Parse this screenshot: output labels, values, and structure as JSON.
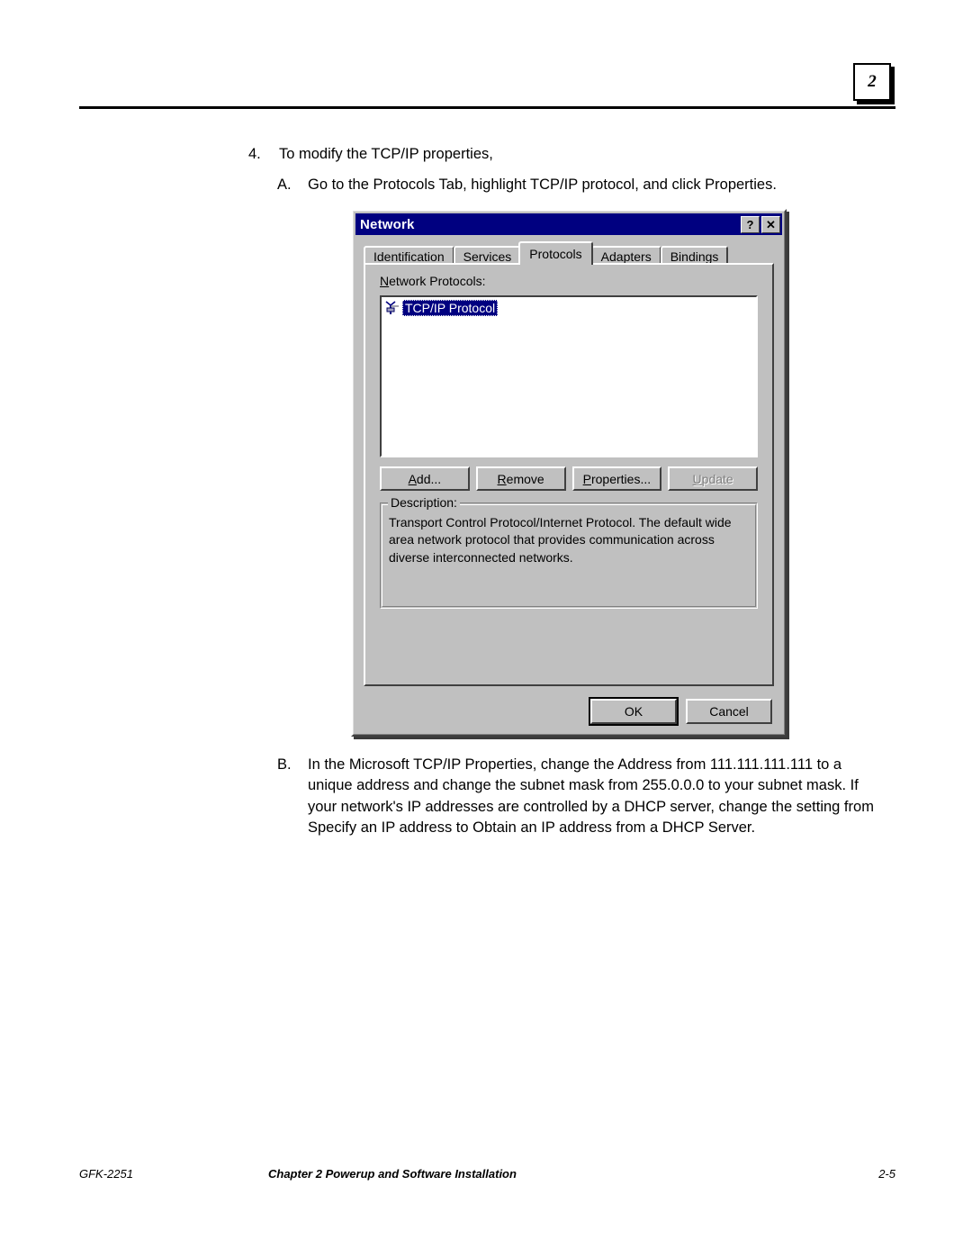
{
  "page": {
    "chapter_marker": "2",
    "footer": {
      "doc_id": "GFK-2251",
      "chapter_title": "Chapter 2  Powerup and Software Installation",
      "page_number": "2-5"
    }
  },
  "instructions": {
    "step4": {
      "marker": "4.",
      "text": "To modify the TCP/IP properties,"
    },
    "step4a": {
      "marker": "A.",
      "text": "Go to the Protocols Tab, highlight TCP/IP protocol, and click Properties."
    },
    "step4b": {
      "marker": "B.",
      "text": "In the Microsoft TCP/IP Properties, change the Address from 111.111.111.111 to a unique address and change the subnet mask from 255.0.0.0 to your subnet mask. If your network's IP addresses are controlled by a DHCP server, change the setting from Specify an IP address to Obtain an IP address from a DHCP Server."
    }
  },
  "dialog": {
    "title": "Network",
    "titlebar_buttons": {
      "help": "?",
      "close": "✕"
    },
    "tabs": [
      {
        "label": "Identification",
        "active": false
      },
      {
        "label": "Services",
        "active": false
      },
      {
        "label": "Protocols",
        "active": true
      },
      {
        "label": "Adapters",
        "active": false
      },
      {
        "label": "Bindings",
        "active": false
      }
    ],
    "protocols_tab": {
      "list_label_prefix": "N",
      "list_label_rest": "etwork Protocols:",
      "items": [
        {
          "label": "TCP/IP Protocol",
          "selected": true,
          "icon": "network-protocol-icon"
        }
      ],
      "buttons": [
        {
          "accel": "A",
          "rest": "dd...",
          "disabled": false
        },
        {
          "accel": "R",
          "rest": "emove",
          "disabled": false
        },
        {
          "accel": "P",
          "rest": "roperties...",
          "disabled": false
        },
        {
          "accel": "U",
          "rest": "pdate",
          "disabled": true
        }
      ],
      "description": {
        "title": "Description:",
        "text": "Transport Control Protocol/Internet Protocol. The default wide area network protocol that provides communication across diverse interconnected networks."
      }
    },
    "footer_buttons": {
      "ok": "OK",
      "cancel": "Cancel"
    }
  },
  "colors": {
    "titlebar": "#000080",
    "face": "#c0c0c0",
    "selection": "#000080",
    "disabled_text": "#808080"
  }
}
